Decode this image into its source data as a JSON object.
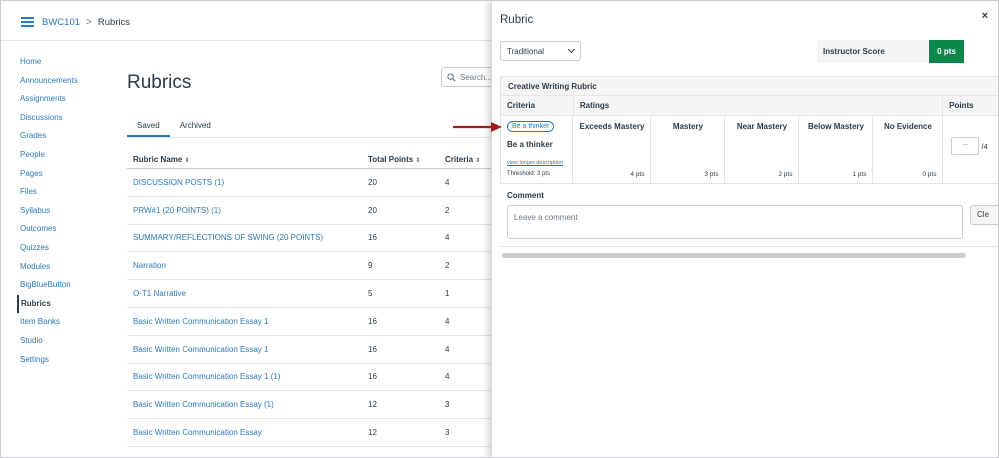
{
  "breadcrumb": {
    "course": "BWC101",
    "separator": ">",
    "current": "Rubrics"
  },
  "nav": [
    "Home",
    "Announcements",
    "Assignments",
    "Discussions",
    "Grades",
    "People",
    "Pages",
    "Files",
    "Syllabus",
    "Outcomes",
    "Quizzes",
    "Modules",
    "BigBlueButton",
    "Rubrics",
    "Item Banks",
    "Studio",
    "Settings"
  ],
  "nav_active_index": 13,
  "page": {
    "title": "Rubrics",
    "search_placeholder": "Search..."
  },
  "tabs": [
    "Saved",
    "Archived"
  ],
  "table": {
    "headers": [
      "Rubric Name",
      "Total Points",
      "Criteria"
    ],
    "rows": [
      [
        "DISCUSSION POSTS (1)",
        "20",
        "4"
      ],
      [
        "PRW#1 (20 POINTS) (1)",
        "20",
        "2"
      ],
      [
        "SUMMARY/REFLECTIONS OF SWING (20 POINTS)",
        "16",
        "4"
      ],
      [
        "Narration",
        "9",
        "2"
      ],
      [
        "O-T1 Narrative",
        "5",
        "1"
      ],
      [
        "Basic Written Communication Essay 1",
        "16",
        "4"
      ],
      [
        "Basic Written Communication Essay 1",
        "16",
        "4"
      ],
      [
        "Basic Written Communication Essay 1 (1)",
        "16",
        "4"
      ],
      [
        "Basic Written Communication Essay (1)",
        "12",
        "3"
      ],
      [
        "Basic Written Communication Essay",
        "12",
        "3"
      ]
    ]
  },
  "tray": {
    "title": "Rubric",
    "close": "×",
    "view_select": "Traditional",
    "score_label": "Instructor Score",
    "score_value": "0 pts",
    "rubric_title": "Creative Writing Rubric",
    "headers": {
      "criteria": "Criteria",
      "ratings": "Ratings",
      "points": "Points"
    },
    "criterion": {
      "pill": "Be a thinker",
      "name": "Be a thinker",
      "link": "view longer description",
      "threshold": "Threshold: 3 pts",
      "points_placeholder": "--",
      "points_max": "/4"
    },
    "ratings": [
      {
        "title": "Exceeds Mastery",
        "points": "4 pts"
      },
      {
        "title": "Mastery",
        "points": "3 pts"
      },
      {
        "title": "Near Mastery",
        "points": "2 pts"
      },
      {
        "title": "Below Mastery",
        "points": "1 pts"
      },
      {
        "title": "No Evidence",
        "points": "0 pts"
      }
    ],
    "comment_label": "Comment",
    "comment_placeholder": "Leave a comment",
    "clear_label": "Cle"
  },
  "colors": {
    "link": "#2b7abc",
    "score_green": "#0b874b",
    "arrow": "#a31c1c"
  }
}
